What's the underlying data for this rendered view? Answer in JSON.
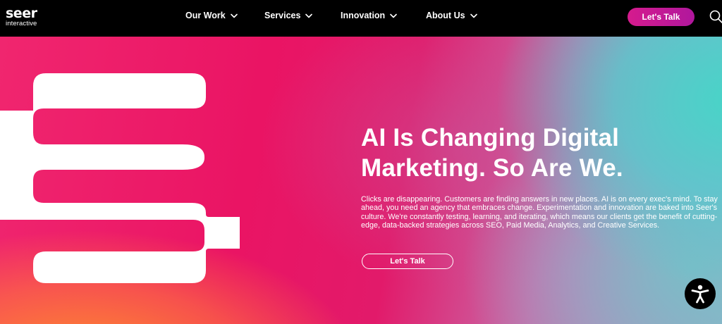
{
  "brand": {
    "name": "seer",
    "tagline": "interactive"
  },
  "nav": {
    "items": [
      {
        "label": "Our Work"
      },
      {
        "label": "Services"
      },
      {
        "label": "Innovation"
      },
      {
        "label": "About Us"
      }
    ],
    "cta_label": "Let's Talk",
    "search_icon": "search-icon"
  },
  "hero": {
    "title_line1": "AI Is Changing Digital",
    "title_line2": "Marketing. So Are We.",
    "body": "Clicks are disappearing. Customers are finding answers in new places. AI is on every exec's mind. To stay ahead, you need an agency that embraces change. Experimentation and innovation are baked into Seer's culture. We're constantly testing, learning, and iterating, which means our clients get the benefit of cutting-edge, data-backed strategies across SEO, Paid Media, Analytics, and Creative Services.",
    "cta_label": "Let's Talk",
    "graphic": "seer-e-mark"
  },
  "accessibility": {
    "icon": "accessibility-icon"
  },
  "colors": {
    "nav_bg": "#000000",
    "cta_gradient_start": "#d51b8d",
    "cta_gradient_end": "#b0179d",
    "hero_pink": "#ea1464",
    "hero_teal": "#48d4c8",
    "hero_orange": "#ff9628"
  }
}
